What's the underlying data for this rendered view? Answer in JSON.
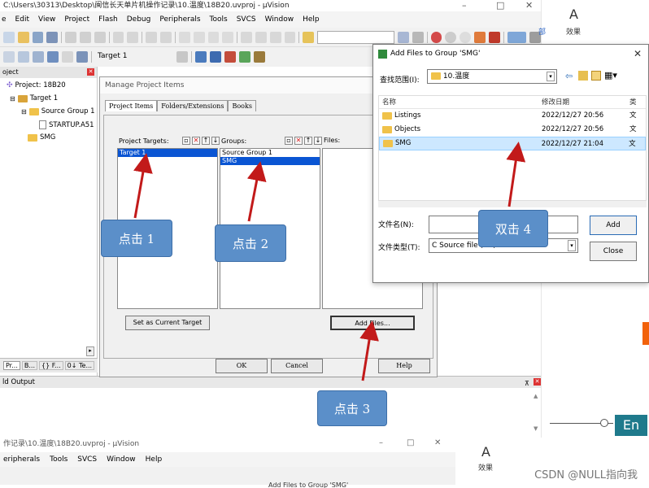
{
  "main_window": {
    "title": "C:\\Users\\30313\\Desktop\\闽信长天单片机操作记录\\10.温度\\18B20.uvproj - µVision",
    "menu": [
      "e",
      "Edit",
      "View",
      "Project",
      "Flash",
      "Debug",
      "Peripherals",
      "Tools",
      "SVCS",
      "Window",
      "Help"
    ],
    "target_combo": "Target 1",
    "window_buttons": [
      "–",
      "□",
      "✕"
    ]
  },
  "right_pane": {
    "icon_label": "A",
    "tab_effect": "效果",
    "tab_partial": "部"
  },
  "project_panel": {
    "header": "oject",
    "items": [
      "Project: 18B20",
      "Target 1",
      "Source Group 1",
      "STARTUP.A51",
      "SMG"
    ],
    "tabs": [
      "Pr...",
      "B...",
      "{} F...",
      "0↓ Te..."
    ]
  },
  "build_output": {
    "title": "ld Output"
  },
  "manage_dialog": {
    "title": "Manage Project Items",
    "tabs": [
      "Project Items",
      "Folders/Extensions",
      "Books"
    ],
    "targets_label": "Project Targets:",
    "targets": [
      "Target 1"
    ],
    "groups_label": "Groups:",
    "groups": [
      "Source Group 1",
      "SMG"
    ],
    "files_label": "Files:",
    "set_current_button": "Set as Current Target",
    "add_files_button": "Add Files...",
    "ok_button": "OK",
    "cancel_button": "Cancel",
    "help_button": "Help"
  },
  "add_files_dialog": {
    "title": "Add Files to Group 'SMG'",
    "look_in_label": "查找范围(I):",
    "look_in_value": "10.温度",
    "col_name": "名称",
    "col_date": "修改日期",
    "col_type": "类",
    "rows": [
      {
        "name": "Listings",
        "date": "2022/12/27 20:56",
        "type": "文"
      },
      {
        "name": "Objects",
        "date": "2022/12/27 20:56",
        "type": "文"
      },
      {
        "name": "SMG",
        "date": "2022/12/27 21:04",
        "type": "文"
      }
    ],
    "filename_label": "文件名(N):",
    "filename_value": "",
    "filetype_label": "文件类型(T):",
    "filetype_value": "C Source file (*.c)",
    "add_button": "Add",
    "close_button": "Close"
  },
  "annotations": {
    "step1": "点击 1",
    "step2": "点击 2",
    "step3": "点击 3",
    "step4": "双击 4"
  },
  "bottom_window": {
    "title": "作记录\\10.温度\\18B20.uvproj - µVision",
    "menu": [
      "eripherals",
      "Tools",
      "SVCS",
      "Window",
      "Help"
    ],
    "effect": "效果",
    "partial_title": "Add Files to Group 'SMG'"
  },
  "ime_label": "En",
  "watermark": "CSDN @NULL指向我"
}
